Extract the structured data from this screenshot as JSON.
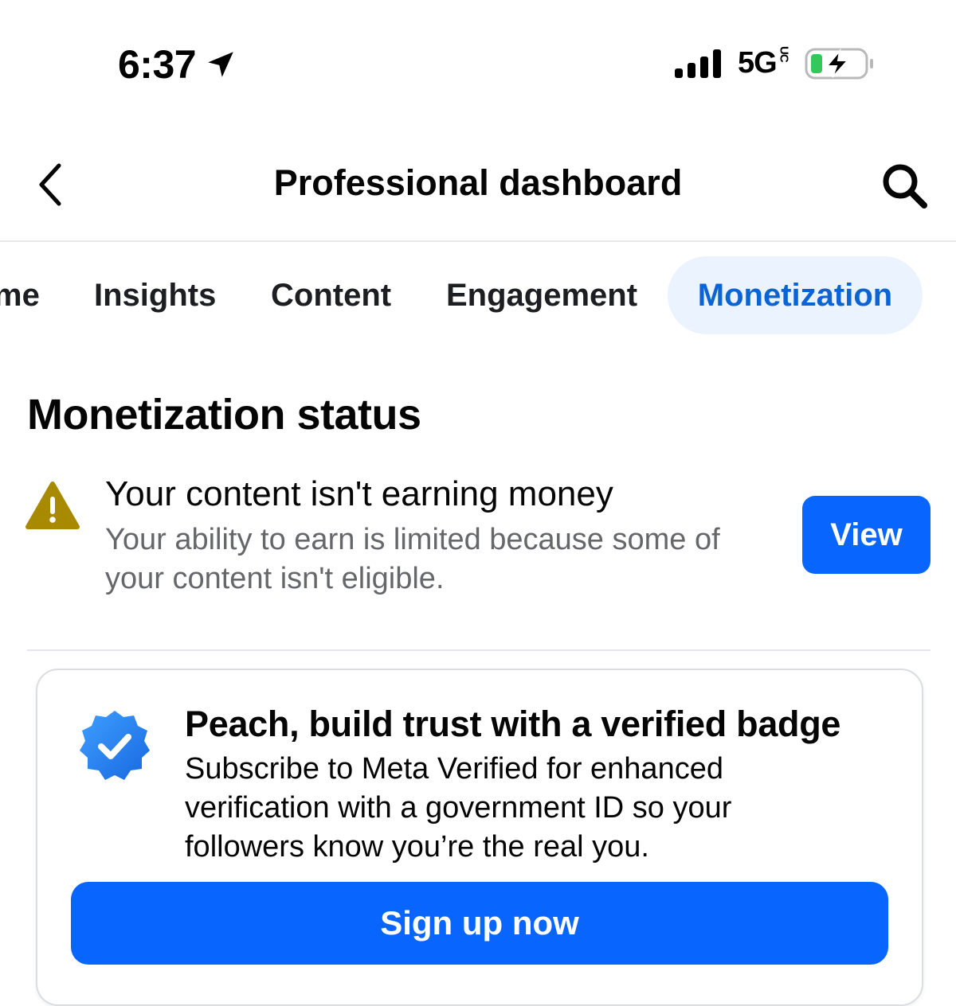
{
  "status_bar": {
    "time": "6:37",
    "network": "5G",
    "network_suffix": "UC",
    "icons": [
      "location-arrow-icon",
      "signal-icon",
      "battery-charging-icon"
    ]
  },
  "header": {
    "title": "Professional dashboard",
    "icons": [
      "back-chevron-icon",
      "search-icon"
    ]
  },
  "tabs": [
    {
      "label": "me",
      "selected": false
    },
    {
      "label": "Insights",
      "selected": false
    },
    {
      "label": "Content",
      "selected": false
    },
    {
      "label": "Engagement",
      "selected": false
    },
    {
      "label": "Monetization",
      "selected": true
    }
  ],
  "monetization": {
    "section_title": "Monetization status",
    "headline": "Your content isn't earning money",
    "description": "Your ability to earn is limited because some of your content isn't eligible.",
    "view_label": "View",
    "warning_icon": "warning-triangle-icon"
  },
  "promo": {
    "title": "Peach, build trust with a verified badge",
    "description": "Subscribe to Meta Verified for enhanced verification with a government ID so your followers know you’re the real you.",
    "button_label": "Sign up now",
    "icon": "verified-badge-icon"
  },
  "colors": {
    "primary_blue": "#0866ff",
    "tab_selected_bg": "#ebf3fe",
    "tab_selected_text": "#0b64d6",
    "warning": "#a88a00",
    "secondary_text": "#65676b"
  }
}
